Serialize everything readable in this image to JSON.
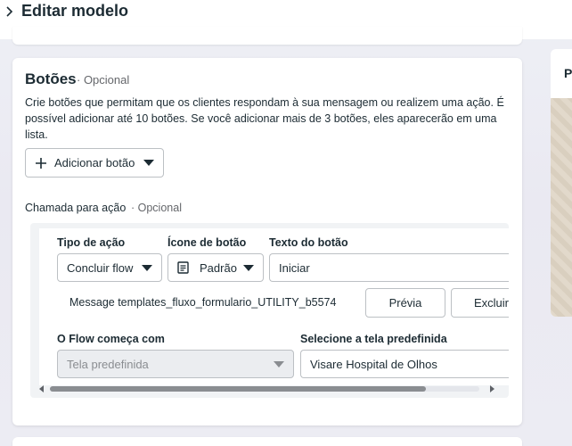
{
  "header": {
    "title": "Editar modelo",
    "chevron_icon": "chevron-right-icon"
  },
  "side_panel": {
    "label": "P"
  },
  "buttons_section": {
    "title": "Botões",
    "optional": "· Opcional",
    "description": "Crie botões que permitam que os clientes respondam à sua mensagem ou realizem uma ação. É possível adicionar até 10 botões. Se você adicionar mais de 3 botões, eles aparecerão em uma lista.",
    "add_button_label": "Adicionar botão"
  },
  "cta": {
    "label": "Chamada para ação",
    "optional": "· Opcional",
    "action_type_label": "Tipo de ação",
    "action_type_value": "Concluir flow",
    "icon_label": "Ícone de botão",
    "icon_value": "Padrão",
    "button_text_label": "Texto do botão",
    "button_text_value": "Iniciar",
    "message_template": "Message templates_fluxo_formulario_UTILITY_b5574",
    "preview_button": "Prévia",
    "delete_button": "Excluir",
    "flow_start_label": "O Flow começa com",
    "flow_start_value": "Tela predefinida",
    "screen_label": "Selecione a tela predefinida",
    "screen_value": "Visare Hospital de Olhos"
  },
  "colors": {
    "text": "#1c2b33",
    "muted": "#65676b",
    "border": "#bcc0c4",
    "disabled_bg": "#ebedf0"
  }
}
